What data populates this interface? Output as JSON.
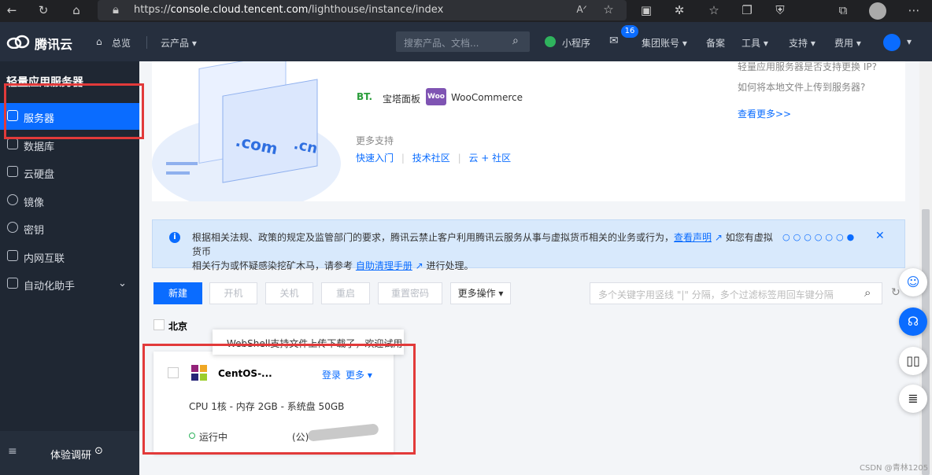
{
  "browser": {
    "url_prefix": "https://",
    "url_domain": "console.cloud.tencent.com",
    "url_path": "/lighthouse/instance/index",
    "icons": [
      "back-icon",
      "refresh-icon",
      "home-icon",
      "lock-icon",
      "read-aloud-icon",
      "favorite-add-icon",
      "extension-icon",
      "puzzle-icon",
      "favorites-icon",
      "collections-icon",
      "shield-icon",
      "apps-icon",
      "profile-icon",
      "more-icon"
    ]
  },
  "header": {
    "brand": "腾讯云",
    "overview": "总览",
    "products": "云产品",
    "search_placeholder": "搜索产品、文档...",
    "miniprogram": "小程序",
    "mail_count": "16",
    "group_account": "集团账号",
    "beian": "备案",
    "tools": "工具",
    "support": "支持",
    "fees": "费用"
  },
  "sidebar": {
    "title": "轻量应用服务器",
    "items": [
      {
        "label": "服务器",
        "icon": "server-icon"
      },
      {
        "label": "数据库",
        "icon": "database-icon"
      },
      {
        "label": "云硬盘",
        "icon": "disk-icon"
      },
      {
        "label": "镜像",
        "icon": "image-icon"
      },
      {
        "label": "密钥",
        "icon": "key-icon"
      },
      {
        "label": "内网互联",
        "icon": "network-icon"
      },
      {
        "label": "自动化助手",
        "icon": "automation-icon"
      }
    ],
    "survey": "体验调研"
  },
  "hero": {
    "apps": [
      {
        "logo": "BT.",
        "label": "宝塔面板"
      },
      {
        "logo": "Woo",
        "label": "WooCommerce"
      }
    ],
    "more_support": "更多支持",
    "links": [
      "快速入门",
      "技术社区",
      "云 + 社区"
    ],
    "faq": [
      "轻量应用服务器是否支持更换 IP?",
      "如何将本地文件上传到服务器?"
    ],
    "see_more": "查看更多>>",
    "illus_com": ".com",
    "illus_cn": ".cn"
  },
  "notice": {
    "text1": "根据相关法规、政策的规定及监管部门的要求，腾讯云禁止客户利用腾讯云服务从事与虚拟货币相关的业务或行为，",
    "link1": "查看声明",
    "text2": "如您有虚拟货币",
    "text3": "相关行为或怀疑感染挖矿木马，请参考",
    "link2": "自助清理手册",
    "text4": "进行处理。"
  },
  "toolbar": {
    "new": "新建",
    "start": "开机",
    "stop": "关机",
    "restart": "重启",
    "reset_pwd": "重置密码",
    "more_ops": "更多操作",
    "filter_placeholder": "多个关键字用竖线 \"|\" 分隔，多个过滤标签用回车键分隔"
  },
  "region": {
    "label": "北京"
  },
  "tooltip": "WebShell支持文件上传下载了，欢迎试用",
  "instance": {
    "name": "CentOS-...",
    "login": "登录",
    "more": "更多",
    "spec": "CPU 1核 - 内存 2GB - 系统盘 50GB",
    "status": "运行中",
    "ip_label": "(公)"
  },
  "watermark": "CSDN @青林1205",
  "colors": {
    "accent": "#0a6cff",
    "sidebar": "#1f2733",
    "header": "#262f3e",
    "highlight": "#e23a3a"
  }
}
